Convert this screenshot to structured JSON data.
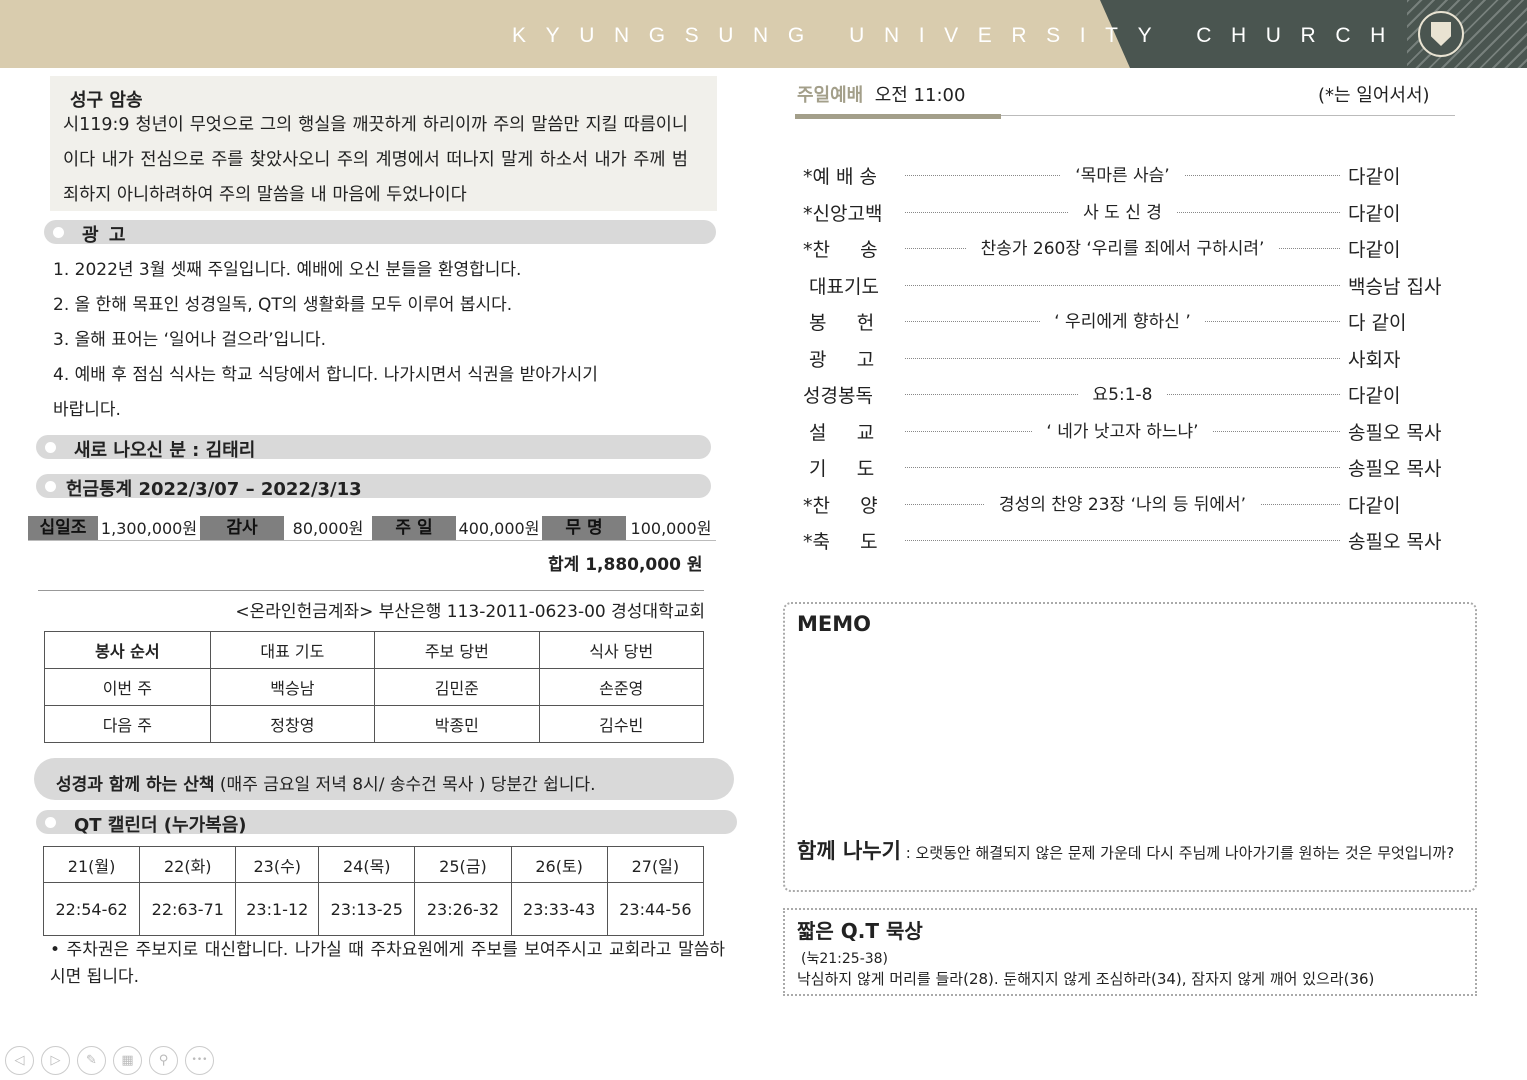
{
  "header": {
    "title": "KYUNGSUNG UNIVERSITY CHURCH",
    "colors": {
      "band": "#d9ccae",
      "dark": "#4a5550"
    }
  },
  "verse": {
    "title": "성구 암송",
    "text": "시119:9 청년이 무엇으로 그의 행실을 깨끗하게 하리이까 주의 말씀만 지킬 따름이니이다 내가 전심으로 주를 찾았사오니 주의 계명에서 떠나지 말게 하소서 내가 주께 범죄하지 아니하려하여 주의 말씀을 내 마음에 두었나이다"
  },
  "announcements": {
    "title": "광  고",
    "items": [
      "1. 2022년 3월 셋째 주일입니다. 예배에 오신 분들을 환영합니다.",
      "2. 올 한해 목표인 성경일독, QT의 생활화를 모두 이루어 봅시다.",
      "3. 올해 표어는 ‘일어나 걸으라’입니다.",
      "4. 예배 후 점심 식사는 학교 식당에서 합니다. 나가시면서 식권을 받아가시기",
      "바랍니다."
    ]
  },
  "newcomer": {
    "label": "새로 나오신 분 : 김태리"
  },
  "offering": {
    "title": "헌금통계 2022/3/07 – 2022/3/13",
    "items": [
      {
        "label": "십일조",
        "value": "1,300,000원"
      },
      {
        "label": "감사",
        "value": "80,000원"
      },
      {
        "label": "주 일",
        "value": "400,000원"
      },
      {
        "label": "무 명",
        "value": "100,000원"
      }
    ],
    "total": "합계  1,880,000 원",
    "account": "<온라인헌금계좌> 부산은행 113-2011-0623-00 경성대학교회"
  },
  "service_table": {
    "headers": [
      "봉사 순서",
      "대표 기도",
      "주보 당번",
      "식사 당번"
    ],
    "rows": [
      [
        "이번 주",
        "백승남",
        "김민준",
        "손준영"
      ],
      [
        "다음 주",
        "정창영",
        "박종민",
        "김수빈"
      ]
    ]
  },
  "walk": {
    "bold": "성경과 함께 하는 산책",
    "rest": " (매주 금요일 저녁 8시/ 송수건 목사 ) 당분간 쉽니다."
  },
  "qt_calendar": {
    "title": "QT 캘린더 (누가복음)",
    "days": [
      "21(월)",
      "22(화)",
      "23(수)",
      "24(목)",
      "25(금)",
      "26(토)",
      "27(일)"
    ],
    "readings": [
      "22:54-62",
      "22:63-71",
      "23:1-12",
      "23:13-25",
      "23:26-32",
      "23:33-43",
      "23:44-56"
    ]
  },
  "parking_note": "• 주차권은 주보지로 대신합니다. 나가실 때 주차요원에게 주보를 보여주시고 교회라고 말씀하시면 됩니다.",
  "worship": {
    "label": "주일예배",
    "time": "오전 11:00",
    "note": "(*는 일어서서)",
    "accent": "#a39f8a",
    "order": [
      {
        "name": "*예 배 송",
        "content": "‘목마른 사슴’",
        "who": "다같이"
      },
      {
        "name": "*신앙고백",
        "content": "사 도 신 경",
        "who": "다같이"
      },
      {
        "name": "*찬     송",
        "content": "찬송가 260장 ‘우리를 죄에서 구하시려’",
        "who": "다같이"
      },
      {
        "name": " 대표기도",
        "content": "",
        "who": "백승남 집사"
      },
      {
        "name": " 봉     헌",
        "content": "‘ 우리에게 향하신 ’",
        "who": "다 같이"
      },
      {
        "name": " 광     고",
        "content": "",
        "who": "사회자"
      },
      {
        "name": "성경봉독",
        "content": "요5:1-8",
        "who": "다같이"
      },
      {
        "name": " 설     교",
        "content": "‘ 네가 낫고자 하느냐’",
        "who": "송필오 목사"
      },
      {
        "name": " 기     도",
        "content": "",
        "who": "송필오 목사"
      },
      {
        "name": "*찬     양",
        "content": "경성의 찬양 23장 ‘나의 등 뒤에서’",
        "who": "다같이"
      },
      {
        "name": "*축     도",
        "content": "",
        "who": "송필오 목사"
      }
    ]
  },
  "memo": {
    "title": "MEMO",
    "share_title": "함께 나누기",
    "share_text": " : 오랫동안 해결되지 않은 문제 가운데 다시 주님께 나아가기를 원하는 것은 무엇입니까?"
  },
  "short_qt": {
    "title": "짧은 Q.T 묵상",
    "ref": "(눅21:25-38)",
    "text": "낙심하지 않게 머리를 들라(28). 둔해지지 않게 조심하라(34), 잠자지 않게 깨어 있으라(36)"
  },
  "toolbar": {
    "icons": [
      "prev-icon",
      "next-icon",
      "pen-icon",
      "slides-icon",
      "zoom-icon",
      "more-icon"
    ],
    "glyphs": [
      "◁",
      "▷",
      "✎",
      "▦",
      "⚲",
      "•••"
    ]
  }
}
